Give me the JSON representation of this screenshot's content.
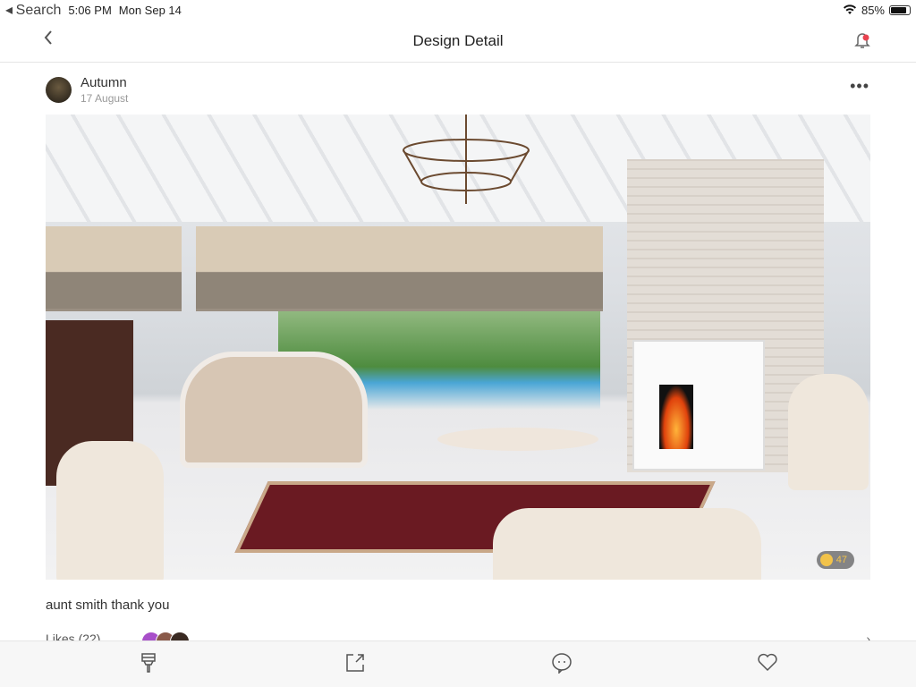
{
  "status": {
    "back_app": "Search",
    "time": "5:06 PM",
    "date": "Mon Sep 14",
    "battery": "85%",
    "battery_level": 0.85
  },
  "nav": {
    "title": "Design Detail",
    "back_icon": "chevron-left-icon",
    "notification_icon": "bell-icon",
    "notification_dot_color": "#e8424f"
  },
  "post": {
    "author": "Autumn",
    "date": "17 August",
    "caption": "aunt smith thank you",
    "tag_count": "47",
    "likes_label": "Likes (22)"
  },
  "toolbar": {
    "items": [
      {
        "icon": "paintbrush-icon"
      },
      {
        "icon": "share-icon"
      },
      {
        "icon": "comment-icon"
      },
      {
        "icon": "heart-icon"
      }
    ]
  }
}
